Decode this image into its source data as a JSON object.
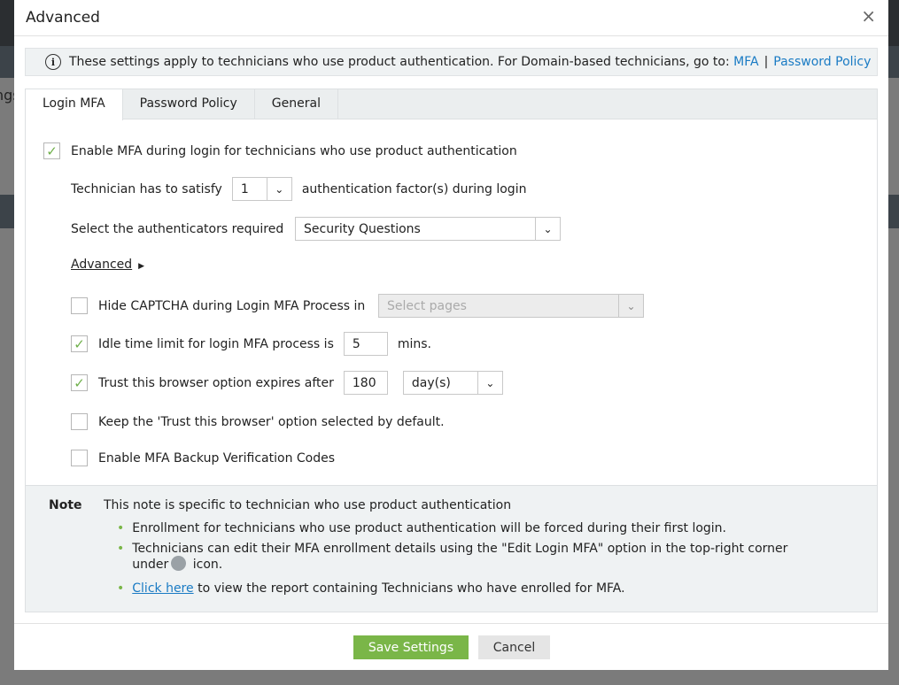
{
  "background": {
    "partial_text": "ngs"
  },
  "dialog": {
    "title": "Advanced",
    "close": "×"
  },
  "info": {
    "text": "These settings apply to technicians who use product authentication. For Domain-based technicians, go to:",
    "link_mfa": "MFA",
    "sep": "|",
    "link_password": "Password Policy"
  },
  "tabs": [
    {
      "label": "Login MFA"
    },
    {
      "label": "Password Policy"
    },
    {
      "label": "General"
    }
  ],
  "form": {
    "enable_mfa": {
      "label": "Enable MFA during login for technicians who use product authentication",
      "checked": true
    },
    "satisfy": {
      "label_before": "Technician has to satisfy",
      "value": "1",
      "label_after": "authentication factor(s) during login"
    },
    "authenticators": {
      "label": "Select the authenticators required",
      "value": "Security Questions"
    },
    "advanced_link": "Advanced",
    "hide_captcha": {
      "label": "Hide CAPTCHA during Login MFA Process in",
      "checked": false,
      "placeholder": "Select pages"
    },
    "idle_time": {
      "label": "Idle time limit for login MFA process is",
      "checked": true,
      "value": "5",
      "unit": "mins."
    },
    "trust_browser": {
      "label": "Trust this browser option expires after",
      "checked": true,
      "value": "180",
      "unit": "day(s)"
    },
    "keep_trust": {
      "label": "Keep the 'Trust this browser' option selected by default.",
      "checked": false
    },
    "backup_codes": {
      "label": "Enable MFA Backup Verification Codes",
      "checked": false
    }
  },
  "note": {
    "heading": "Note",
    "intro": "This note is specific to technician who use product authentication",
    "b1": "Enrollment for technicians who use product authentication will be forced during their first login.",
    "b2a": "Technicians can edit their MFA enrollment details using the \"Edit Login MFA\" option in the top-right corner",
    "b2b": "under",
    "b2c": "icon.",
    "b3_link": "Click here",
    "b3": "to view the report containing Technicians who have enrolled for MFA."
  },
  "buttons": {
    "save": "Save Settings",
    "cancel": "Cancel"
  },
  "colors": {
    "accent": "#7ab648",
    "link": "#1a7bc4"
  }
}
